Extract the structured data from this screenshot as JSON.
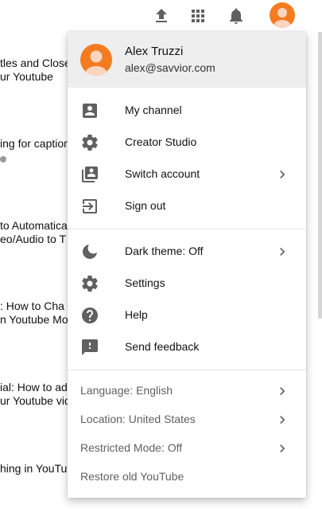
{
  "topbar": {
    "icons": [
      "upload-icon",
      "apps-grid-icon",
      "notifications-bell-icon",
      "account-avatar"
    ]
  },
  "background": {
    "items": [
      {
        "line1": "tles and Close",
        "line2": "ur Youtube"
      },
      {
        "line1": "ing for caption"
      },
      {
        "line1": "to Automatica",
        "line2": "eo/Audio to T"
      },
      {
        "line1": ": How to Cha",
        "line2": "n Youtube Mo"
      },
      {
        "line1": "ial: How to add",
        "line2": "ur Youtube vid"
      },
      {
        "line1": "hing in YouTu"
      }
    ]
  },
  "menu": {
    "account": {
      "name": "Alex Truzzi",
      "email": "alex@savvior.com"
    },
    "section1": [
      {
        "label": "My channel",
        "icon": "person-badge-icon",
        "chevron": false
      },
      {
        "label": "Creator Studio",
        "icon": "gear-icon",
        "chevron": false
      },
      {
        "label": "Switch account",
        "icon": "switch-account-icon",
        "chevron": true
      },
      {
        "label": "Sign out",
        "icon": "sign-out-icon",
        "chevron": false
      }
    ],
    "section2": [
      {
        "label": "Dark theme: Off",
        "icon": "moon-icon",
        "chevron": true
      },
      {
        "label": "Settings",
        "icon": "gear-icon",
        "chevron": false
      },
      {
        "label": "Help",
        "icon": "help-icon",
        "chevron": false
      },
      {
        "label": "Send feedback",
        "icon": "feedback-icon",
        "chevron": false
      }
    ],
    "section3": [
      {
        "label": "Language: English",
        "chevron": true
      },
      {
        "label": "Location: United States",
        "chevron": true
      },
      {
        "label": "Restricted Mode: Off",
        "chevron": true
      },
      {
        "label": "Restore old YouTube",
        "chevron": false
      }
    ]
  },
  "colors": {
    "avatar": "#f47c20",
    "icon": "#606060",
    "header_bg": "#eeeeee"
  }
}
